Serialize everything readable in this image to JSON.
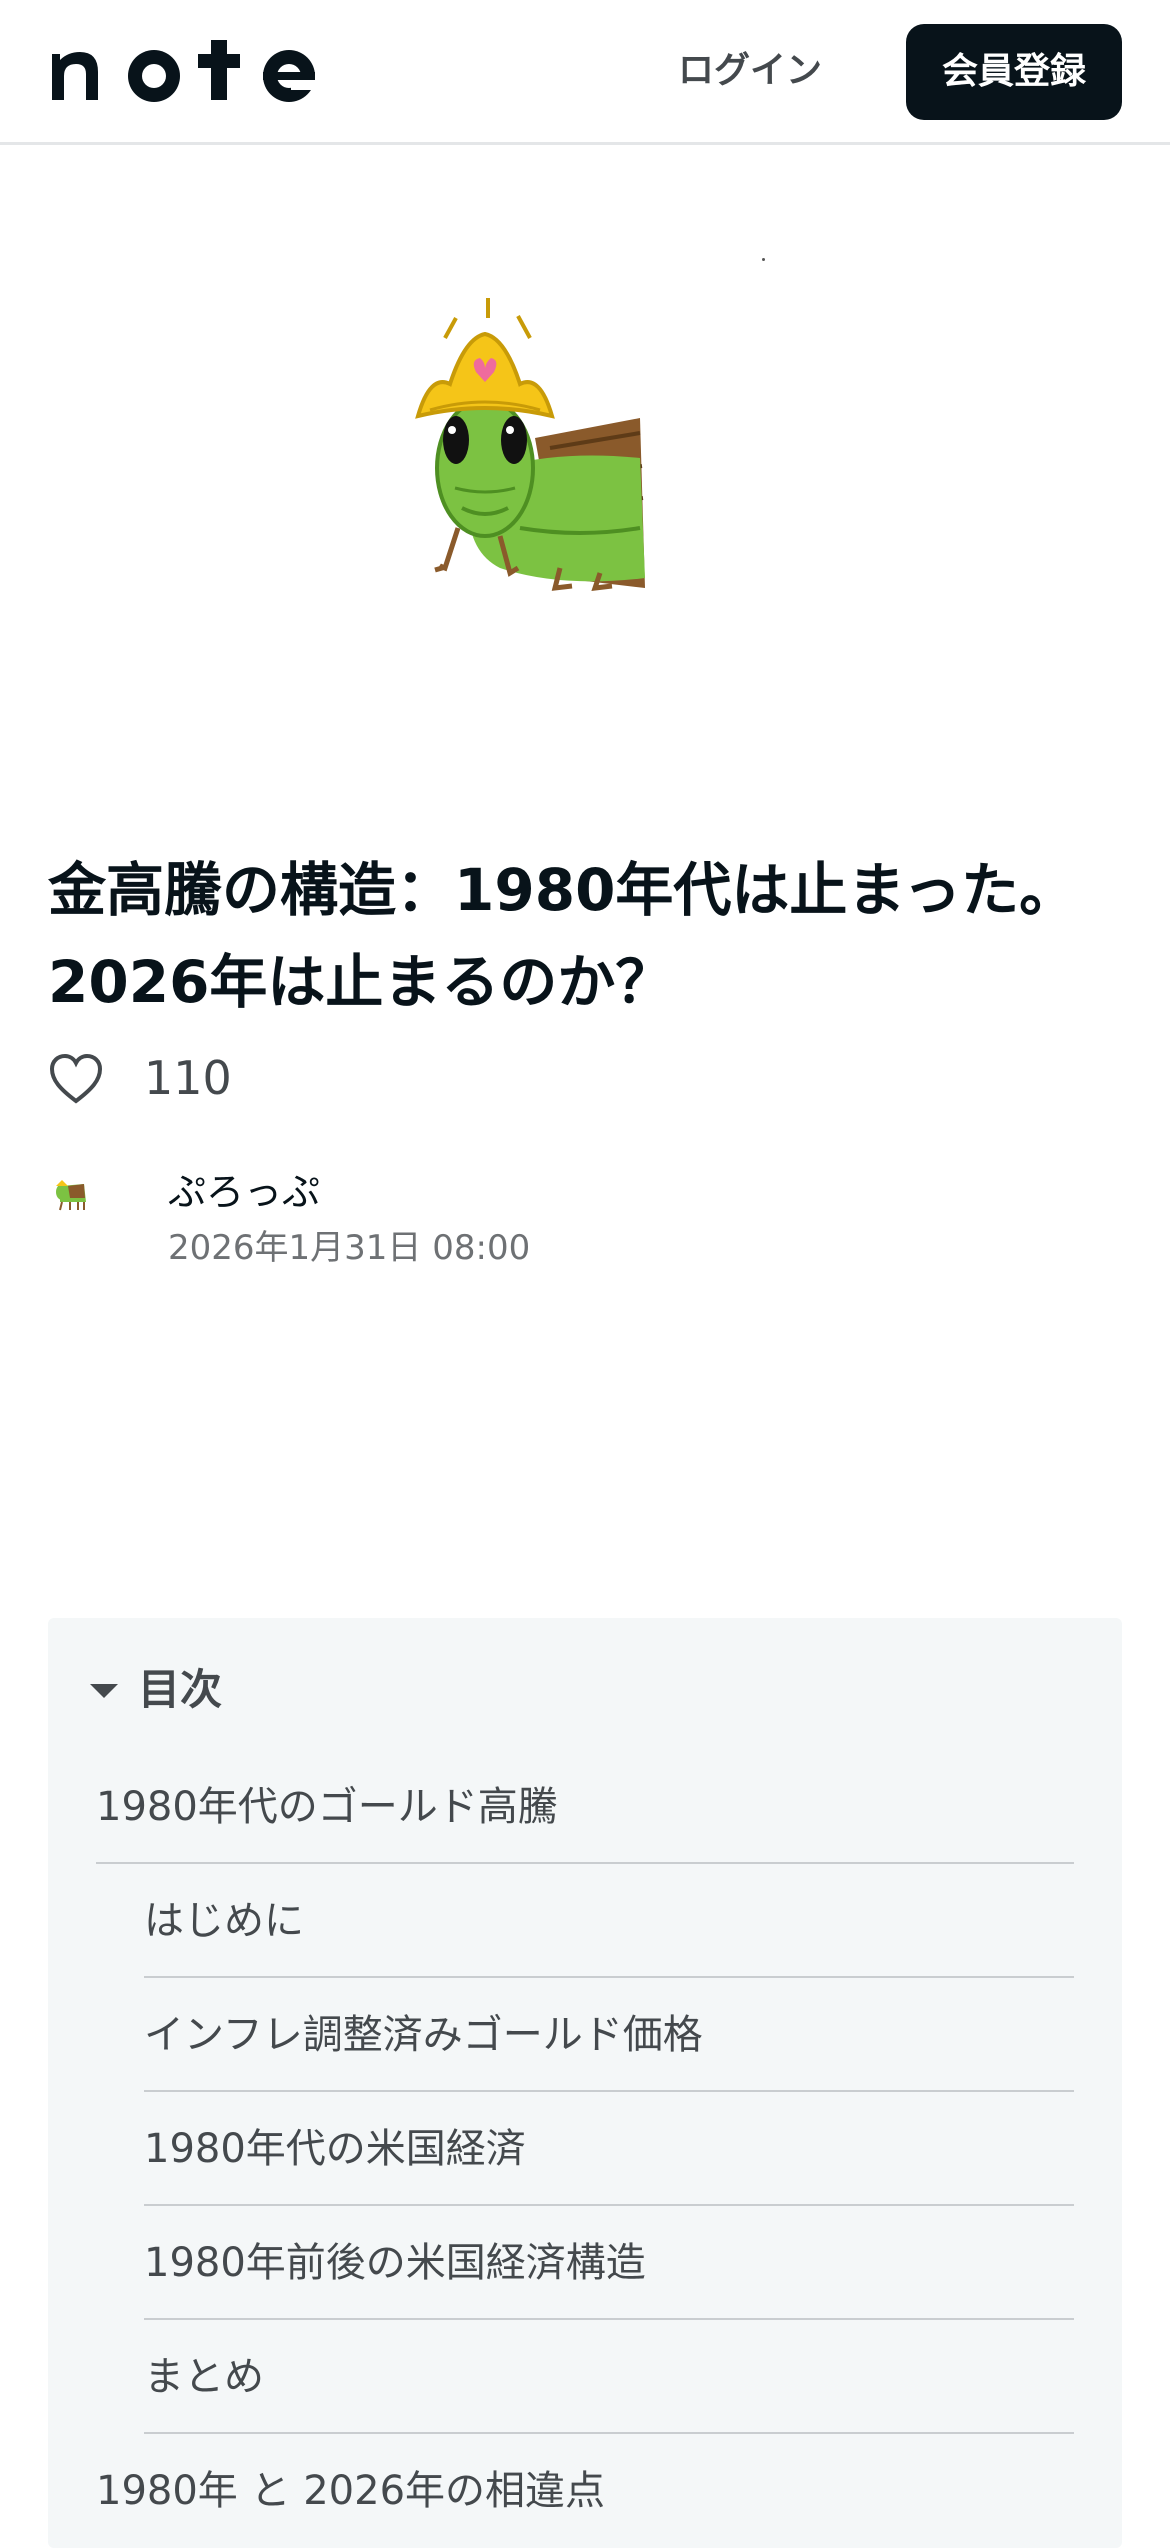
{
  "header": {
    "logo_text": "note",
    "login_label": "ログイン",
    "signup_label": "会員登録"
  },
  "article": {
    "title": "金高騰の構造：1980年代は止まった。2026年は止まるのか？",
    "likes": "110",
    "author": "ぷろっぷ",
    "date": "2026年1月31日 08:00"
  },
  "toc": {
    "title": "目次",
    "items": [
      {
        "label": "1980年代のゴールド高騰",
        "level": 1
      },
      {
        "label": "はじめに",
        "level": 2
      },
      {
        "label": "インフレ調整済みゴールド価格",
        "level": 2
      },
      {
        "label": "1980年代の米国経済",
        "level": 2
      },
      {
        "label": "1980年前後の米国経済構造",
        "level": 2
      },
      {
        "label": "まとめ",
        "level": 2
      },
      {
        "label": "1980年 と 2026年の相違点",
        "level": 1
      }
    ]
  },
  "colors": {
    "primary": "#08131a",
    "text_secondary": "#44494d",
    "toc_background": "#f4f7f8",
    "insect_green": "#7cc242",
    "crown_gold": "#f5c518",
    "wing_brown": "#8a5a2b"
  },
  "icons": {
    "like": "heart-outline-icon",
    "toc_toggle": "caret-down-icon"
  }
}
